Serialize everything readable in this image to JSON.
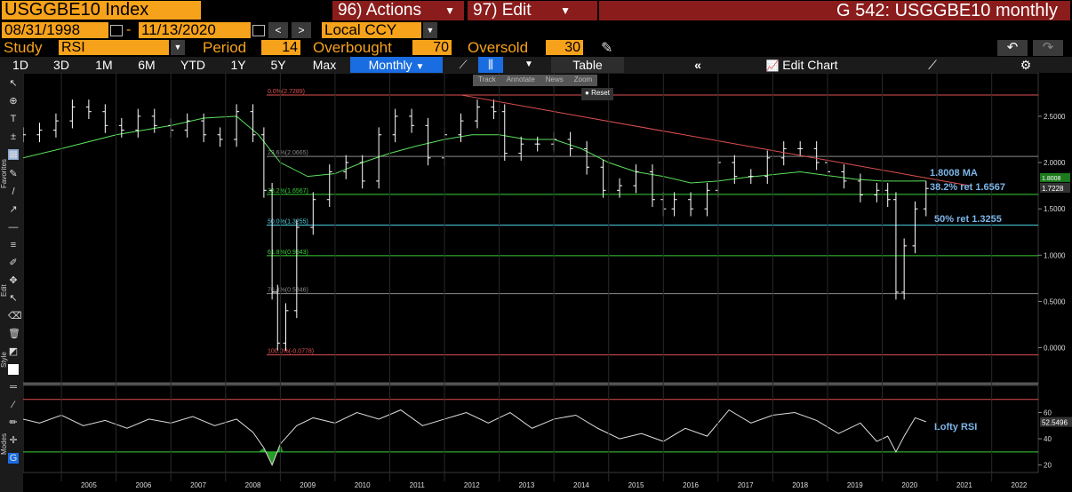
{
  "header": {
    "ticker": "USGGBE10 Index",
    "actions_label": "96) Actions",
    "edit_label": "97) Edit",
    "title": "G 542: USGGBE10 monthly"
  },
  "daterange": {
    "start": "08/31/1998",
    "end": "11/13/2020",
    "currency": "Local CCY"
  },
  "study": {
    "label": "Study",
    "name": "RSI",
    "period_label": "Period",
    "period": "14",
    "overbought_label": "Overbought",
    "overbought": "70",
    "oversold_label": "Oversold",
    "oversold": "30"
  },
  "tabs": [
    "1D",
    "3D",
    "1M",
    "6M",
    "YTD",
    "1Y",
    "5Y",
    "Max"
  ],
  "frequency": "Monthly",
  "table_label": "Table",
  "edit_chart_label": "Edit Chart",
  "mini_toolbar": [
    "Track",
    "Annotate",
    "News",
    "Zoom"
  ],
  "reset_label": "Reset",
  "sidebar_labels": {
    "favorites": "Favorites",
    "edit": "Edit",
    "style": "Style",
    "modes": "Modes"
  },
  "colors": {
    "accent": "#f7a21b",
    "header_red": "#8a1c1c",
    "selected_tab": "#1a6de0",
    "ma_line": "#5be05b",
    "fib_green": "#39d039",
    "fib_cyan": "#4fd0e6",
    "trend_red": "#e05050",
    "annotation": "#7bb6ea"
  },
  "chart_data": {
    "type": "line",
    "title": "",
    "x_ticks": [
      "2005",
      "2006",
      "2007",
      "2008",
      "2009",
      "2010",
      "2011",
      "2012",
      "2013",
      "2014",
      "2015",
      "2016",
      "2017",
      "2018",
      "2019",
      "2020",
      "2021",
      "2022"
    ],
    "ylim": [
      -0.35,
      2.95
    ],
    "y_ticks": [
      "2.5000",
      "2.0000",
      "1.5000",
      "1.0000",
      "0.5000",
      "0.0000"
    ],
    "fib_levels": [
      {
        "label": "0.0%(2.7289)",
        "value": 2.7289,
        "color": "#e05050"
      },
      {
        "label": "23.6%(2.0665)",
        "value": 2.0665,
        "color": "#8a8a8a"
      },
      {
        "label": "38.2%(1.6567)",
        "value": 1.6567,
        "color": "#39d039"
      },
      {
        "label": "50.0%(1.3255)",
        "value": 1.3255,
        "color": "#4fd0e6"
      },
      {
        "label": "61.8%(0.9943)",
        "value": 0.9943,
        "color": "#39d039"
      },
      {
        "label": "76.4%(0.5846)",
        "value": 0.5846,
        "color": "#8a8a8a"
      },
      {
        "label": "100.0%(-0.0778)",
        "value": -0.0778,
        "color": "#e05050"
      }
    ],
    "price_series": {
      "name": "USGGBE10",
      "x": [
        2004.3,
        2004.6,
        2004.9,
        2005.2,
        2005.5,
        2005.8,
        2006.1,
        2006.4,
        2006.7,
        2007.0,
        2007.3,
        2007.6,
        2007.9,
        2008.2,
        2008.5,
        2008.7,
        2008.85,
        2008.95,
        2009.1,
        2009.3,
        2009.6,
        2009.9,
        2010.2,
        2010.5,
        2010.8,
        2011.1,
        2011.4,
        2011.7,
        2012.0,
        2012.3,
        2012.6,
        2012.9,
        2013.1,
        2013.4,
        2013.7,
        2014.0,
        2014.3,
        2014.6,
        2014.9,
        2015.2,
        2015.5,
        2015.8,
        2016.0,
        2016.2,
        2016.5,
        2016.8,
        2017.0,
        2017.3,
        2017.6,
        2017.9,
        2018.2,
        2018.5,
        2018.8,
        2019.0,
        2019.3,
        2019.6,
        2019.9,
        2020.1,
        2020.25,
        2020.4,
        2020.6,
        2020.8
      ],
      "values": [
        2.3,
        2.35,
        2.45,
        2.6,
        2.55,
        2.4,
        2.35,
        2.5,
        2.4,
        2.35,
        2.45,
        2.3,
        2.25,
        2.55,
        2.3,
        1.7,
        0.6,
        0.05,
        0.4,
        1.3,
        1.6,
        1.9,
        2.0,
        1.8,
        2.3,
        2.5,
        2.4,
        2.05,
        2.3,
        2.45,
        2.6,
        2.55,
        2.1,
        2.2,
        2.2,
        2.25,
        2.15,
        1.95,
        1.7,
        1.75,
        1.9,
        1.6,
        1.5,
        1.6,
        1.5,
        1.7,
        2.0,
        1.85,
        1.85,
        2.05,
        2.15,
        2.15,
        2.0,
        1.9,
        1.8,
        1.65,
        1.7,
        1.6,
        0.6,
        1.1,
        1.5,
        1.72
      ]
    },
    "ma_series": {
      "name": "MA",
      "x": [
        2004.3,
        2005.0,
        2006.0,
        2007.0,
        2007.6,
        2008.2,
        2008.6,
        2009.0,
        2009.5,
        2010.0,
        2010.5,
        2011.0,
        2011.5,
        2012.0,
        2012.5,
        2013.0,
        2013.5,
        2014.0,
        2014.5,
        2015.0,
        2015.5,
        2016.0,
        2016.5,
        2017.0,
        2017.5,
        2018.0,
        2018.5,
        2019.0,
        2019.5,
        2020.0,
        2020.5,
        2020.8
      ],
      "values": [
        2.05,
        2.15,
        2.3,
        2.4,
        2.48,
        2.5,
        2.3,
        2.0,
        1.85,
        1.88,
        2.0,
        2.1,
        2.18,
        2.25,
        2.3,
        2.3,
        2.25,
        2.25,
        2.15,
        2.0,
        1.9,
        1.85,
        1.78,
        1.8,
        1.84,
        1.87,
        1.9,
        1.86,
        1.82,
        1.8,
        1.8,
        1.8008
      ]
    },
    "trendline": {
      "x": [
        2012.3,
        2021.6
      ],
      "values": [
        2.73,
        1.75
      ]
    },
    "last_value": "1.7228",
    "ma_value_tag": "1.8008",
    "annotations": [
      "1.8008 MA",
      "38.2% ret 1.6567",
      "50% ret 1.3255"
    ],
    "rsi": {
      "name": "Lofty RSI",
      "ylim": [
        17,
        78
      ],
      "y_ticks": [
        "60",
        "40",
        "20"
      ],
      "overbought": 70,
      "oversold": 30,
      "last_value": "52.5496",
      "x": [
        2004.3,
        2004.6,
        2005.0,
        2005.4,
        2005.8,
        2006.2,
        2006.6,
        2007.0,
        2007.4,
        2007.8,
        2008.2,
        2008.5,
        2008.7,
        2008.85,
        2009.0,
        2009.3,
        2009.6,
        2010.0,
        2010.4,
        2010.8,
        2011.2,
        2011.6,
        2012.0,
        2012.4,
        2012.8,
        2013.2,
        2013.6,
        2014.0,
        2014.4,
        2014.8,
        2015.2,
        2015.6,
        2016.0,
        2016.4,
        2016.8,
        2017.2,
        2017.6,
        2018.0,
        2018.4,
        2018.8,
        2019.2,
        2019.6,
        2019.9,
        2020.1,
        2020.25,
        2020.4,
        2020.6,
        2020.8
      ],
      "values": [
        55,
        52,
        58,
        50,
        54,
        48,
        55,
        52,
        57,
        50,
        55,
        45,
        33,
        20,
        36,
        50,
        56,
        52,
        60,
        55,
        62,
        50,
        55,
        60,
        52,
        60,
        48,
        55,
        58,
        48,
        40,
        44,
        38,
        48,
        42,
        62,
        52,
        58,
        60,
        54,
        44,
        52,
        38,
        42,
        30,
        42,
        56,
        53
      ]
    }
  }
}
